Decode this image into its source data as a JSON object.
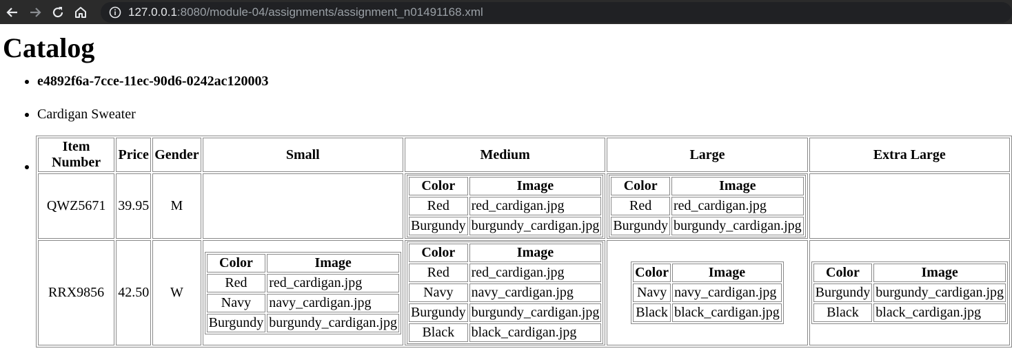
{
  "browser": {
    "url_host": "127.0.0.1",
    "url_rest": ":8080/module-04/assignments/assignment_n01491168.xml"
  },
  "page": {
    "title": "Catalog",
    "product_id": "e4892f6a-7cce-11ec-90d6-0242ac120003",
    "product_name": "Cardigan Sweater"
  },
  "table": {
    "headers": [
      "Item Number",
      "Price",
      "Gender",
      "Small",
      "Medium",
      "Large",
      "Extra Large"
    ],
    "sub_headers": [
      "Color",
      "Image"
    ],
    "rows": [
      {
        "item_number": "QWZ5671",
        "price": "39.95",
        "gender": "M",
        "sizes": [
          [],
          [
            [
              "Red",
              "red_cardigan.jpg"
            ],
            [
              "Burgundy",
              "burgundy_cardigan.jpg"
            ]
          ],
          [
            [
              "Red",
              "red_cardigan.jpg"
            ],
            [
              "Burgundy",
              "burgundy_cardigan.jpg"
            ]
          ],
          []
        ]
      },
      {
        "item_number": "RRX9856",
        "price": "42.50",
        "gender": "W",
        "sizes": [
          [
            [
              "Red",
              "red_cardigan.jpg"
            ],
            [
              "Navy",
              "navy_cardigan.jpg"
            ],
            [
              "Burgundy",
              "burgundy_cardigan.jpg"
            ]
          ],
          [
            [
              "Red",
              "red_cardigan.jpg"
            ],
            [
              "Navy",
              "navy_cardigan.jpg"
            ],
            [
              "Burgundy",
              "burgundy_cardigan.jpg"
            ],
            [
              "Black",
              "black_cardigan.jpg"
            ]
          ],
          [
            [
              "Navy",
              "navy_cardigan.jpg"
            ],
            [
              "Black",
              "black_cardigan.jpg"
            ]
          ],
          [
            [
              "Burgundy",
              "burgundy_cardigan.jpg"
            ],
            [
              "Black",
              "black_cardigan.jpg"
            ]
          ]
        ]
      }
    ]
  }
}
